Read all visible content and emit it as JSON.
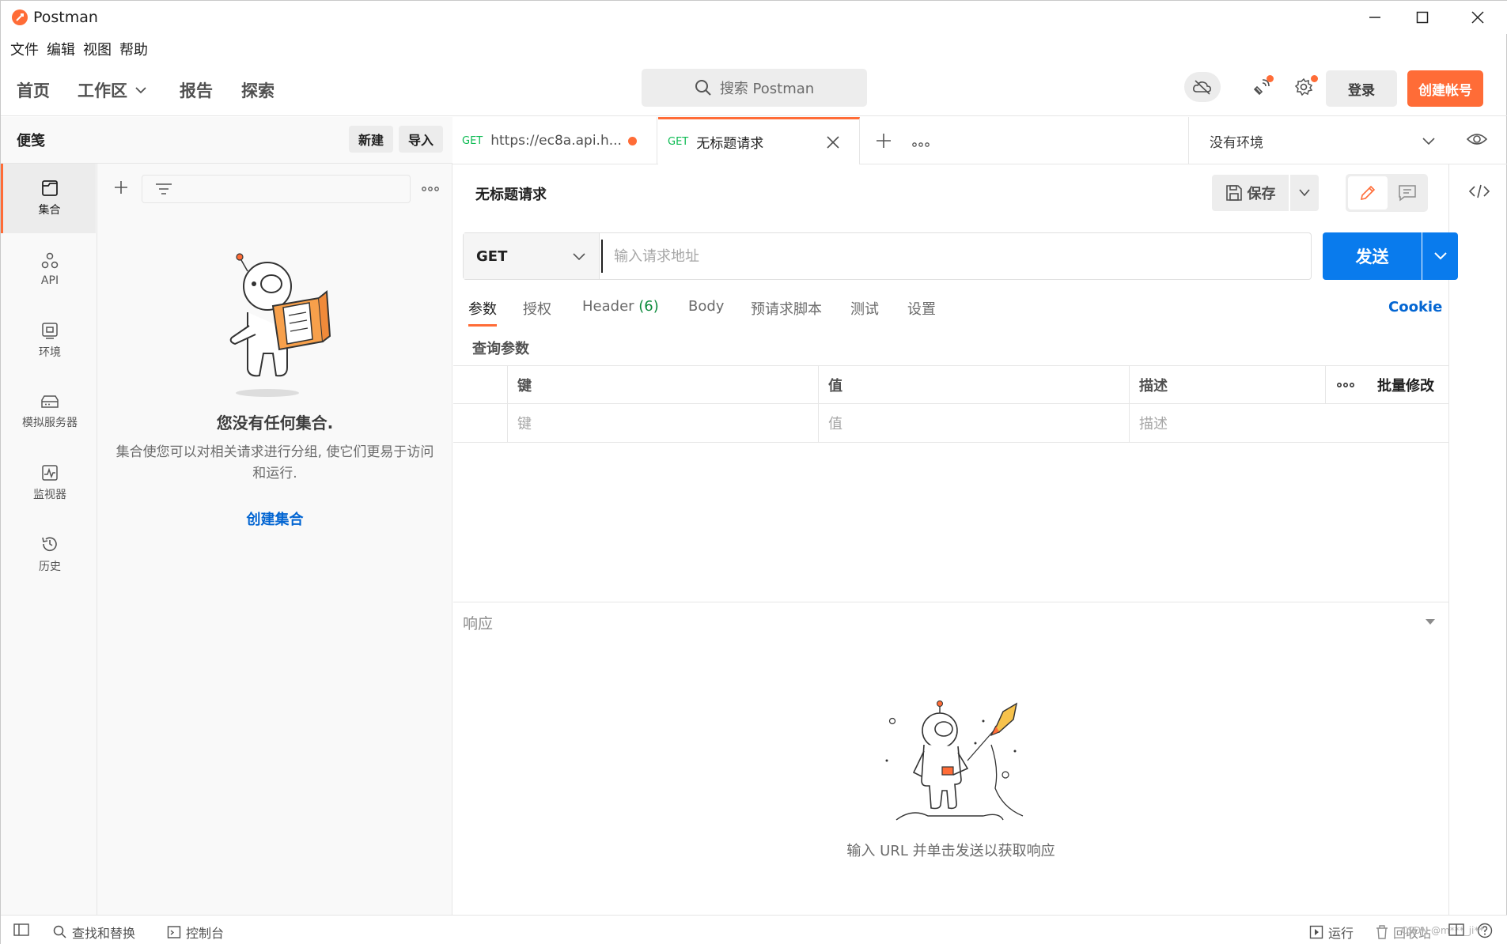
{
  "window": {
    "title": "Postman"
  },
  "menu": {
    "items": [
      "文件",
      "编辑",
      "视图",
      "帮助"
    ]
  },
  "header": {
    "nav": {
      "home": "首页",
      "workspaces": "工作区",
      "reports": "报告",
      "explore": "探索"
    },
    "search_placeholder": "搜索 Postman",
    "sign_in": "登录",
    "create_account": "创建帐号"
  },
  "sidebar": {
    "title": "便笺",
    "new_label": "新建",
    "import_label": "导入",
    "rail": [
      {
        "label": "集合",
        "icon": "collections-icon",
        "active": true
      },
      {
        "label": "API",
        "icon": "api-icon",
        "active": false
      },
      {
        "label": "环境",
        "icon": "environment-icon",
        "active": false
      },
      {
        "label": "模拟服务器",
        "icon": "mock-server-icon",
        "active": false
      },
      {
        "label": "监视器",
        "icon": "monitor-icon",
        "active": false
      },
      {
        "label": "历史",
        "icon": "history-icon",
        "active": false
      }
    ],
    "empty": {
      "title": "您没有任何集合.",
      "description": "集合使您可以对相关请求进行分组, 使它们更易于访问和运行.",
      "create_link": "创建集合"
    }
  },
  "tabs": [
    {
      "method": "GET",
      "name": "https://ec8a.api.h...",
      "unsaved": true,
      "active": false
    },
    {
      "method": "GET",
      "name": "无标题请求",
      "unsaved": false,
      "active": true
    }
  ],
  "environment": {
    "selected": "没有环境"
  },
  "request": {
    "title": "无标题请求",
    "save_label": "保存",
    "method": "GET",
    "url": "",
    "url_placeholder": "输入请求地址",
    "send_label": "发送",
    "tabs": [
      "参数",
      "授权",
      "Header",
      "Body",
      "预请求脚本",
      "测试",
      "设置"
    ],
    "header_count": "(6)",
    "cookie_label": "Cookie",
    "query_title": "查询参数",
    "params_table": {
      "headers": {
        "key": "键",
        "value": "值",
        "description": "描述",
        "bulk_edit": "批量修改"
      },
      "placeholders": {
        "key": "键",
        "value": "值",
        "description": "描述"
      }
    }
  },
  "response": {
    "title": "响应",
    "empty_message": "输入 URL 并单击发送以获取响应"
  },
  "statusbar": {
    "find_replace": "查找和替换",
    "console": "控制台",
    "runner": "运行",
    "trash": "回收站",
    "watermark": "CSDN @m***_ji**"
  },
  "colors": {
    "brand": "#ff6c37",
    "send": "#097bed",
    "link": "#0265d2",
    "method_get": "#0cbb52"
  }
}
